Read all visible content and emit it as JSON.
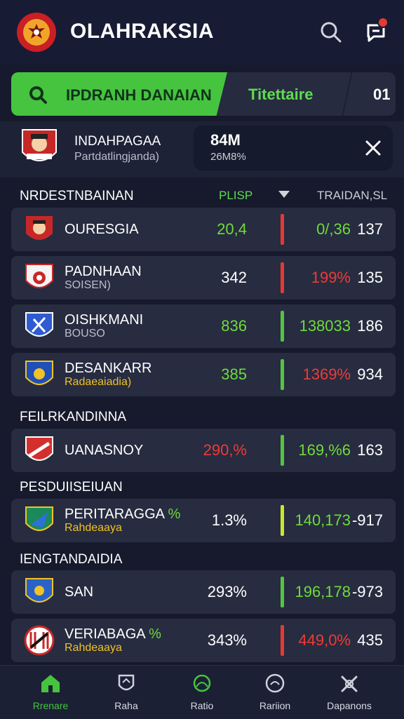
{
  "app": {
    "title": "OLAHRAKSIA"
  },
  "tabs": [
    {
      "label": "IPDRANH DANAIAN"
    },
    {
      "label": "Titettaire"
    },
    {
      "label": "01"
    }
  ],
  "featured": {
    "name": "INDAHPAGAA",
    "subtitle": "Partdatlingjanda)",
    "value": "84M",
    "pct": "26M8%"
  },
  "columns": {
    "name": "NRDESTNBAINAN",
    "score": "PLISP",
    "trend": "TRAIDAN,SL"
  },
  "sections": [
    {
      "title": "NRDESTNBAINAN"
    },
    {
      "title": "FEILRKANDINNA"
    },
    {
      "title": "PESDUIISEIUAN"
    },
    {
      "title": "IENGTANDAIDIA"
    }
  ],
  "rows": [
    {
      "name": "OURESGIA",
      "sub": "",
      "score": "20,4",
      "pct": "0/,36",
      "num": "137",
      "score_color": "#6fdb3c",
      "pct_color": "#6fdb3c",
      "bar_color": "#e53935"
    },
    {
      "name": "PADNHAAN",
      "sub": "SOISEN)",
      "score": "342",
      "pct": "199%",
      "num": "135",
      "score_color": "#ffffff",
      "pct_color": "#ef3b36",
      "bar_color": "#e53935"
    },
    {
      "name": "OISHKMANI",
      "sub": "BOUSO",
      "score": "836",
      "pct": "138033",
      "num": "186",
      "score_color": "#6fdb3c",
      "pct_color": "#6fdb3c",
      "bar_color": "#55c43f"
    },
    {
      "name": "DESANKARR",
      "sub": "Radaeaiadia)",
      "score": "385",
      "pct": "1369%",
      "num": "934",
      "score_color": "#6fdb3c",
      "pct_color": "#ef3b36",
      "bar_color": "#55c43f"
    },
    {
      "name": "UANASNOY",
      "sub": "",
      "score": "290,%",
      "pct": "169,%6",
      "num": "163",
      "score_color": "#ef3b36",
      "pct_color": "#6fdb3c",
      "bar_color": "#55c43f"
    },
    {
      "name": "PERITARAGGA",
      "name_suffix": "%",
      "sub": "Rahdeaaya",
      "score": "1.3%",
      "pct": "140,173",
      "num": "-917",
      "score_color": "#ffffff",
      "pct_color": "#6fdb3c",
      "bar_color": "#c9e62f"
    },
    {
      "name": "SAN",
      "sub": "",
      "score": "293%",
      "pct": "196,178",
      "num": "-973",
      "score_color": "#ffffff",
      "pct_color": "#6fdb3c",
      "bar_color": "#55c43f"
    },
    {
      "name": "VERIABAGA",
      "name_suffix": "%",
      "sub": "Rahdeaaya",
      "score": "343%",
      "pct": "449,0%",
      "num": "435",
      "score_color": "#ffffff",
      "pct_color": "#ef3b36",
      "bar_color": "#e53935"
    }
  ],
  "nav": [
    {
      "label": "Rrenare",
      "icon": "home-icon"
    },
    {
      "label": "Raha",
      "icon": "shield-icon"
    },
    {
      "label": "Ratio",
      "icon": "ball-icon"
    },
    {
      "label": "Rariion",
      "icon": "chart-icon"
    },
    {
      "label": "Dapanons",
      "icon": "crossed-icon"
    }
  ],
  "colors": {
    "green": "#46c43f",
    "red": "#e53935",
    "bg": "#161a2c",
    "card": "#272c40"
  }
}
